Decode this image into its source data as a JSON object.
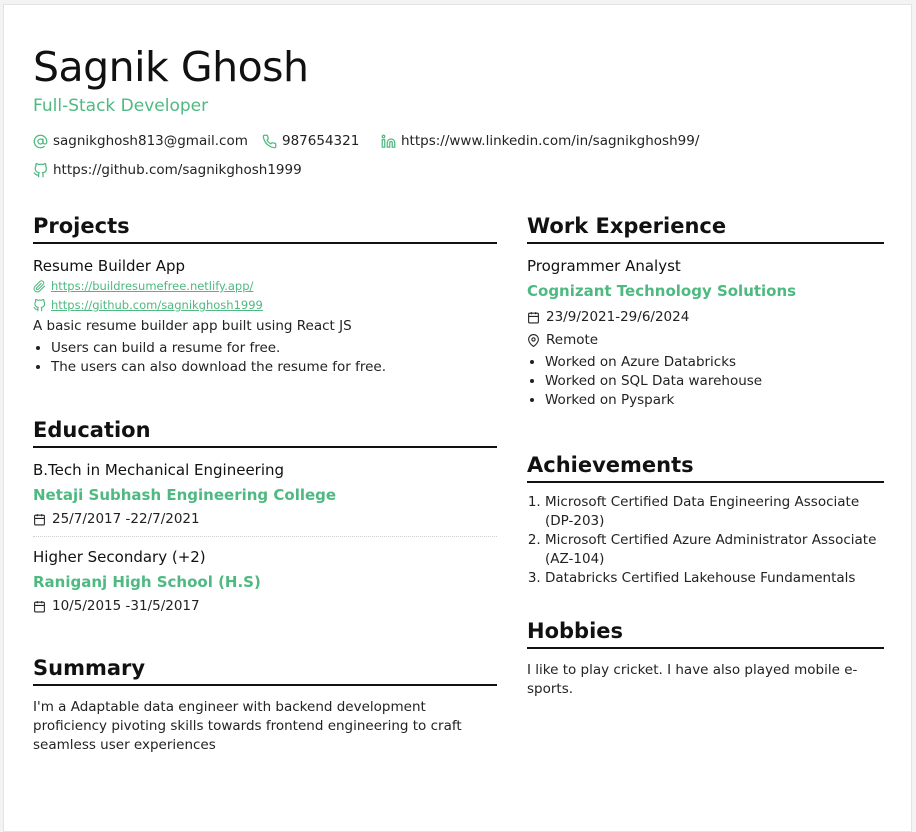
{
  "header": {
    "name": "Sagnik Ghosh",
    "role": "Full-Stack Developer",
    "email": "sagnikghosh813@gmail.com",
    "phone": "987654321",
    "linkedin": "https://www.linkedin.com/in/sagnikghosh99/",
    "github": "https://github.com/sagnikghosh1999"
  },
  "projects": {
    "title": "Projects",
    "items": [
      {
        "name": "Resume Builder App",
        "live_link": "https://buildresumefree.netlify.app/",
        "repo_link": "https://github.com/sagnikghosh1999",
        "description": "A basic resume builder app built using React JS",
        "bullets": [
          "Users can build a resume for free.",
          "The users can also download the resume for free."
        ]
      }
    ]
  },
  "education": {
    "title": "Education",
    "items": [
      {
        "degree": "B.Tech in Mechanical Engineering",
        "school": "Netaji Subhash Engineering College",
        "dates": "25/7/2017 -22/7/2021"
      },
      {
        "degree": "Higher Secondary (+2)",
        "school": "Raniganj High School (H.S)",
        "dates": "10/5/2015 -31/5/2017"
      }
    ]
  },
  "summary": {
    "title": "Summary",
    "text": "I'm a Adaptable data engineer with backend development proficiency pivoting skills towards frontend engineering to craft seamless user experiences"
  },
  "work": {
    "title": "Work Experience",
    "items": [
      {
        "position": "Programmer Analyst",
        "company": "Cognizant Technology Solutions",
        "dates": "23/9/2021-29/6/2024",
        "location": "Remote",
        "bullets": [
          "Worked on Azure Databricks",
          "Worked on SQL Data warehouse",
          "Worked on Pyspark"
        ]
      }
    ]
  },
  "achievements": {
    "title": "Achievements",
    "items": [
      "Microsoft Certified Data Engineering Associate (DP-203)",
      "Microsoft Certified Azure Administrator Associate (AZ-104)",
      "Databricks Certified Lakehouse Fundamentals"
    ]
  },
  "hobbies": {
    "title": "Hobbies",
    "text": "I like to play cricket. I have also played mobile e-sports."
  },
  "colors": {
    "accent": "#4eb980",
    "text": "#111111"
  },
  "icons": [
    "at-icon",
    "phone-icon",
    "linkedin-icon",
    "github-icon",
    "paperclip-icon",
    "calendar-icon",
    "location-pin-icon"
  ]
}
